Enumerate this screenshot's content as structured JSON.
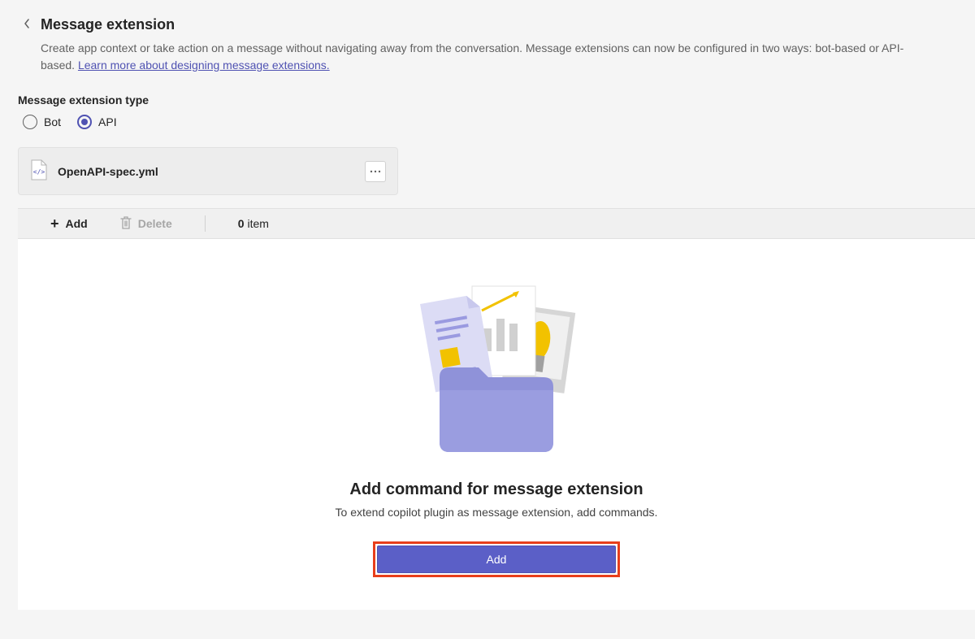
{
  "header": {
    "title": "Message extension",
    "description_pre": "Create app context or take action on a message without navigating away from the conversation. Message extensions can now be configured in two ways: bot-based or API-based. ",
    "description_link": "Learn more about designing message extensions."
  },
  "type_section": {
    "label": "Message extension type",
    "options": {
      "bot": "Bot",
      "api": "API"
    },
    "selected": "api"
  },
  "file": {
    "name": "OpenAPI-spec.yml"
  },
  "toolbar": {
    "add_label": "Add",
    "delete_label": "Delete",
    "count_value": "0",
    "count_unit": "item"
  },
  "empty": {
    "title": "Add command for message extension",
    "description": "To extend copilot plugin as message extension, add commands.",
    "button": "Add"
  }
}
